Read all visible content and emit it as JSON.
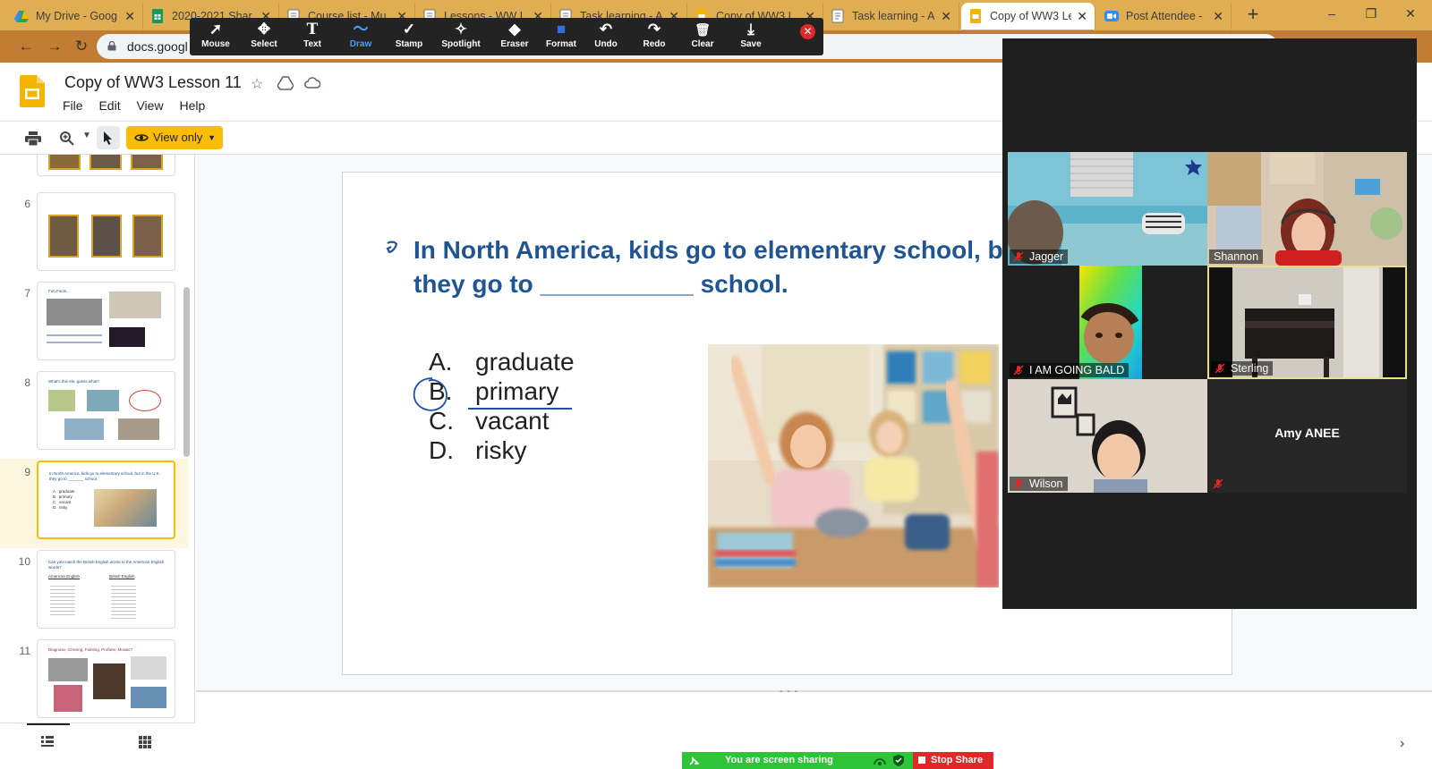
{
  "browser": {
    "tabs": [
      {
        "title": "My Drive - Goog",
        "icon": "google-drive-icon",
        "color": "#1fa463"
      },
      {
        "title": "2020-2021 Shar",
        "icon": "google-sheets-icon",
        "color": "#0f9d58"
      },
      {
        "title": "Course list - Mu",
        "icon": "page-icon",
        "color": "#ffffff"
      },
      {
        "title": "Lessons - WW L",
        "icon": "page-icon",
        "color": "#ffffff"
      },
      {
        "title": "Task learning - A",
        "icon": "page-icon",
        "color": "#ffffff"
      },
      {
        "title": "Copy of WW3 L",
        "icon": "google-slides-icon",
        "color": "#f4b400"
      },
      {
        "title": "Task learning - A",
        "icon": "page-icon",
        "color": "#ffffff"
      },
      {
        "title": "Copy of WW3 Le",
        "icon": "google-slides-icon",
        "color": "#f4b400",
        "active": true
      },
      {
        "title": "Post Attendee -",
        "icon": "zoom-icon",
        "color": "#2d8cff"
      }
    ],
    "new_tab_glyph": "+",
    "url": "docs.googl",
    "window_controls": [
      "–",
      "❐",
      "✕"
    ]
  },
  "annotate_toolbar": {
    "tools": [
      {
        "label": "Mouse",
        "glyph": "➚",
        "icon": "mouse-pointer-icon"
      },
      {
        "label": "Select",
        "glyph": "✥",
        "icon": "move-select-icon"
      },
      {
        "label": "Text",
        "glyph": "T",
        "icon": "text-icon"
      },
      {
        "label": "Draw",
        "glyph": "〜",
        "icon": "draw-icon",
        "active": true
      },
      {
        "label": "Stamp",
        "glyph": "✓",
        "icon": "stamp-check-icon"
      },
      {
        "label": "Spotlight",
        "glyph": "✧",
        "icon": "spotlight-wand-icon"
      },
      {
        "label": "Eraser",
        "glyph": "◆",
        "icon": "eraser-icon"
      },
      {
        "label": "Format",
        "glyph": "■",
        "icon": "format-color-icon"
      },
      {
        "label": "Undo",
        "glyph": "↶",
        "icon": "undo-icon"
      },
      {
        "label": "Redo",
        "glyph": "↷",
        "icon": "redo-icon"
      },
      {
        "label": "Clear",
        "glyph": "🗑",
        "icon": "trash-icon"
      },
      {
        "label": "Save",
        "glyph": "⤓",
        "icon": "save-download-icon"
      }
    ],
    "close_glyph": "✕",
    "active_color": "#4a9bff"
  },
  "slides_app": {
    "title": "Copy of WW3 Lesson 11",
    "menu": [
      "File",
      "Edit",
      "View",
      "Help"
    ],
    "view_only_label": "View only",
    "accent": "#fbbc04"
  },
  "filmstrip": {
    "visible_numbers": [
      "6",
      "7",
      "8",
      "9",
      "10",
      "11"
    ],
    "selected": "9",
    "thumb_texts": {
      "t7_title": "Fun Facts...",
      "t8_title": "What's this ele, guess what?",
      "t9_line1": "In North America, kids go to elementary school, but in the U.K.",
      "t9_line2": "they go to _______ school.",
      "t9_opts": "A.  graduate\nB.  primary\nC.  vacant\nD.  risky",
      "t10_title": "Can you match the British English words to the American English words?",
      "t10_col1": "American English",
      "t10_col2": "British English",
      "t11_title": "Diagnose, Grieving, Fainting, Profane, Mosaic?"
    }
  },
  "slide": {
    "question_line1": "In North America, kids go to elementary school, but in the U.K.",
    "question_line2": "they go to ___________ school.",
    "options": [
      {
        "letter": "A.",
        "text": "graduate"
      },
      {
        "letter": "B.",
        "text": "primary"
      },
      {
        "letter": "C.",
        "text": "vacant"
      },
      {
        "letter": "D.",
        "text": "risky"
      }
    ],
    "title_color": "#1f5593",
    "annotation_color": "#1f4fa8"
  },
  "zoom": {
    "participants": [
      {
        "name": "Jagger",
        "muted": true
      },
      {
        "name": "Shannon",
        "muted": false
      },
      {
        "name": "I AM GOING BALD",
        "muted": true
      },
      {
        "name": "Sterling",
        "muted": true,
        "speaking": true
      },
      {
        "name": "Wilson",
        "muted": true
      },
      {
        "name": "Amy ANEE",
        "muted": true,
        "video": false
      }
    ],
    "share_status": "You are screen sharing",
    "stop_share_label": "Stop Share",
    "share_green": "#2dc43a",
    "stop_red": "#e02828"
  }
}
